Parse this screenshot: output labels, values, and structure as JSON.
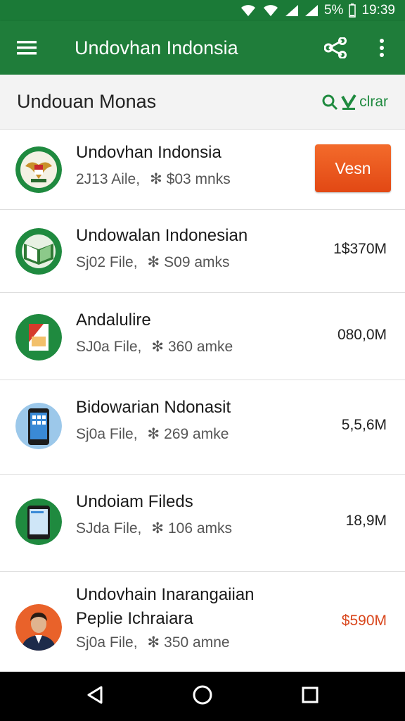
{
  "status_bar": {
    "battery": "5%",
    "time": "19:39"
  },
  "app_bar": {
    "title": "Undovhan Indonsia"
  },
  "sub_header": {
    "title": "Undouan Monas",
    "action_label": "clrar"
  },
  "items": [
    {
      "title": "Undovhan Indonsia",
      "file_label": "2J13 Aile,",
      "count_label": "$03 mnks",
      "button_label": "Vesn"
    },
    {
      "title": "Undowalan Indonesian",
      "file_label": "Sj02 File,",
      "count_label": "S09 amks",
      "size": "1$370M"
    },
    {
      "title": "Andalulire",
      "file_label": "SJ0a File,",
      "count_label": "360 amke",
      "size": "080,0M"
    },
    {
      "title": "Bidowarian Ndonasit",
      "file_label": "Sj0a File,",
      "count_label": "269 amke",
      "size": "5,5,6M"
    },
    {
      "title": "Undoiam Fileds",
      "file_label": "SJda File,",
      "count_label": "106 amks",
      "size": "18,9M"
    },
    {
      "title": "Undovhain Inarangaiian",
      "subtitle": "Peplie Ichraiara",
      "file_label": "Sj0a File,",
      "count_label": "350 amne",
      "size": "$590M"
    }
  ],
  "colors": {
    "primary": "#1f7d3a",
    "accent": "#e24814",
    "clear_action": "#1f8a3f"
  }
}
